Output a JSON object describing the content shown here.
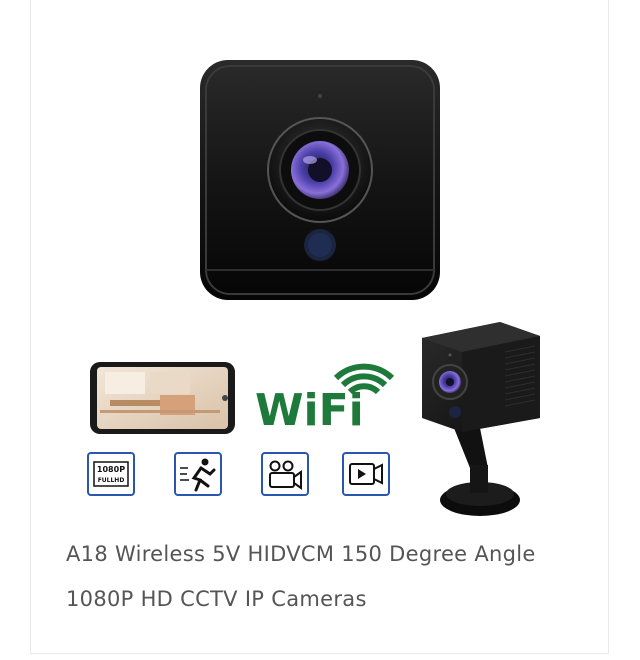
{
  "product": {
    "title": "A18 Wireless 5V HIDVCM 150 Degree Angle 1080P HD CCTV IP Cameras"
  },
  "image": {
    "wifi_logo_text": "WiFi",
    "badge_resolution": "1080P",
    "badge_resolution_sub": "FULLHD",
    "colors": {
      "wifi_green": "#1e7a3a",
      "badge_blue": "#2a55b0",
      "camera_body": "#141414",
      "lens_purple": "#6a5acd"
    },
    "icons": [
      "phone-preview",
      "wifi-logo",
      "full-hd-badge",
      "motion-detection-icon",
      "video-camera-icon",
      "video-playback-icon",
      "mini-camera-on-stand"
    ]
  }
}
